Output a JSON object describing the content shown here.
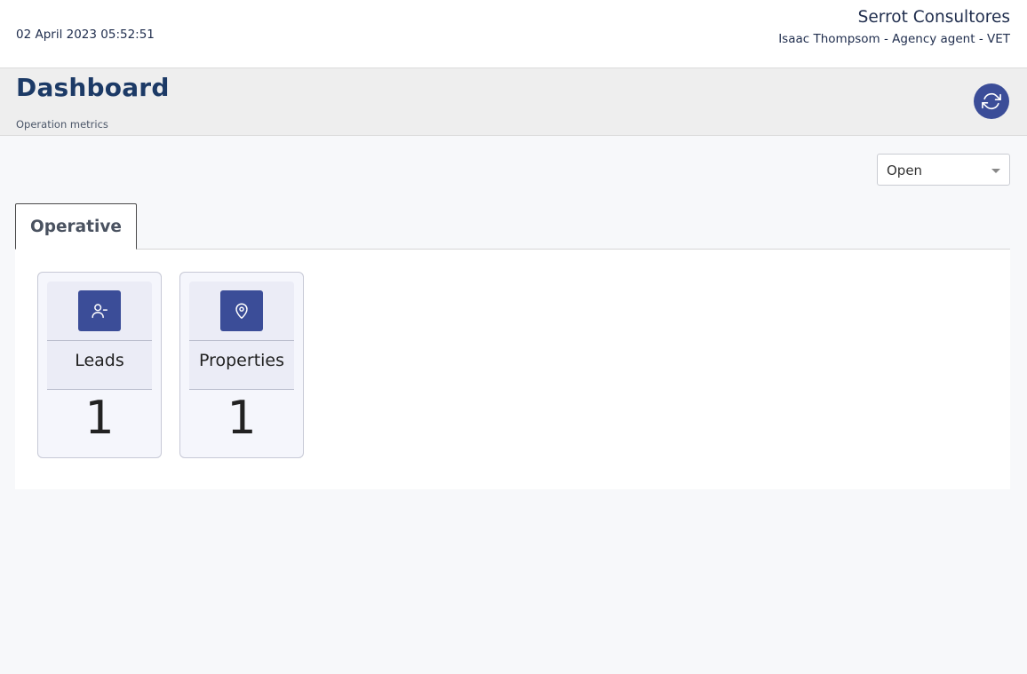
{
  "header": {
    "datetime": "02 April 2023 05:52:51",
    "company": "Serrot Consultores",
    "user_line": "Isaac Thompsom - Agency agent - VET"
  },
  "page": {
    "title": "Dashboard",
    "subtitle": "Operation metrics",
    "refresh_icon": "refresh-icon"
  },
  "filter": {
    "selected": "Open"
  },
  "tabs": [
    {
      "label": "Operative",
      "active": true
    }
  ],
  "cards": [
    {
      "label": "Leads",
      "value": "1",
      "icon": "user-minus-icon"
    },
    {
      "label": "Properties",
      "value": "1",
      "icon": "map-pin-icon"
    }
  ],
  "colors": {
    "accent": "#3b4d98",
    "title": "#1c3a66",
    "text": "#1f2d4d"
  }
}
